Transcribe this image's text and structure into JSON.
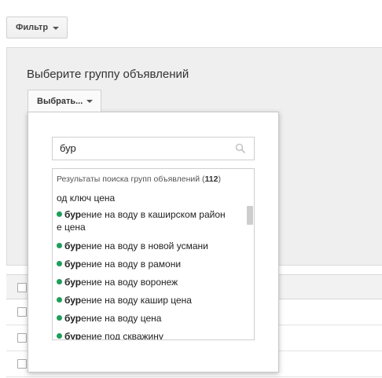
{
  "filter_button": {
    "label": "Фильтр",
    "icon": "caret-down"
  },
  "panel": {
    "title": "Выберите группу объявлений",
    "choose_button": {
      "label": "Выбрать...",
      "icon": "caret-down"
    }
  },
  "popup": {
    "search": {
      "value": "бур",
      "icon": "search-icon"
    },
    "results_header": {
      "prefix": "Результаты поиска групп объявлений (",
      "count": "112",
      "suffix": ")"
    },
    "partial_top_item": "од ключ цена",
    "items": [
      {
        "match": "бур",
        "rest": "ение на воду в каширском район",
        "rest2": "е цена"
      },
      {
        "match": "бур",
        "rest": "ение на воду в новой усмани"
      },
      {
        "match": "бур",
        "rest": "ение на воду в рамони"
      },
      {
        "match": "бур",
        "rest": "ение на воду воронеж"
      },
      {
        "match": "бур",
        "rest": "ение на воду кашир цена"
      },
      {
        "match": "бур",
        "rest": "ение на воду цена"
      },
      {
        "match": "бур",
        "rest": "ение под скважину"
      }
    ],
    "status_dot_color": "#1e9e5a"
  }
}
